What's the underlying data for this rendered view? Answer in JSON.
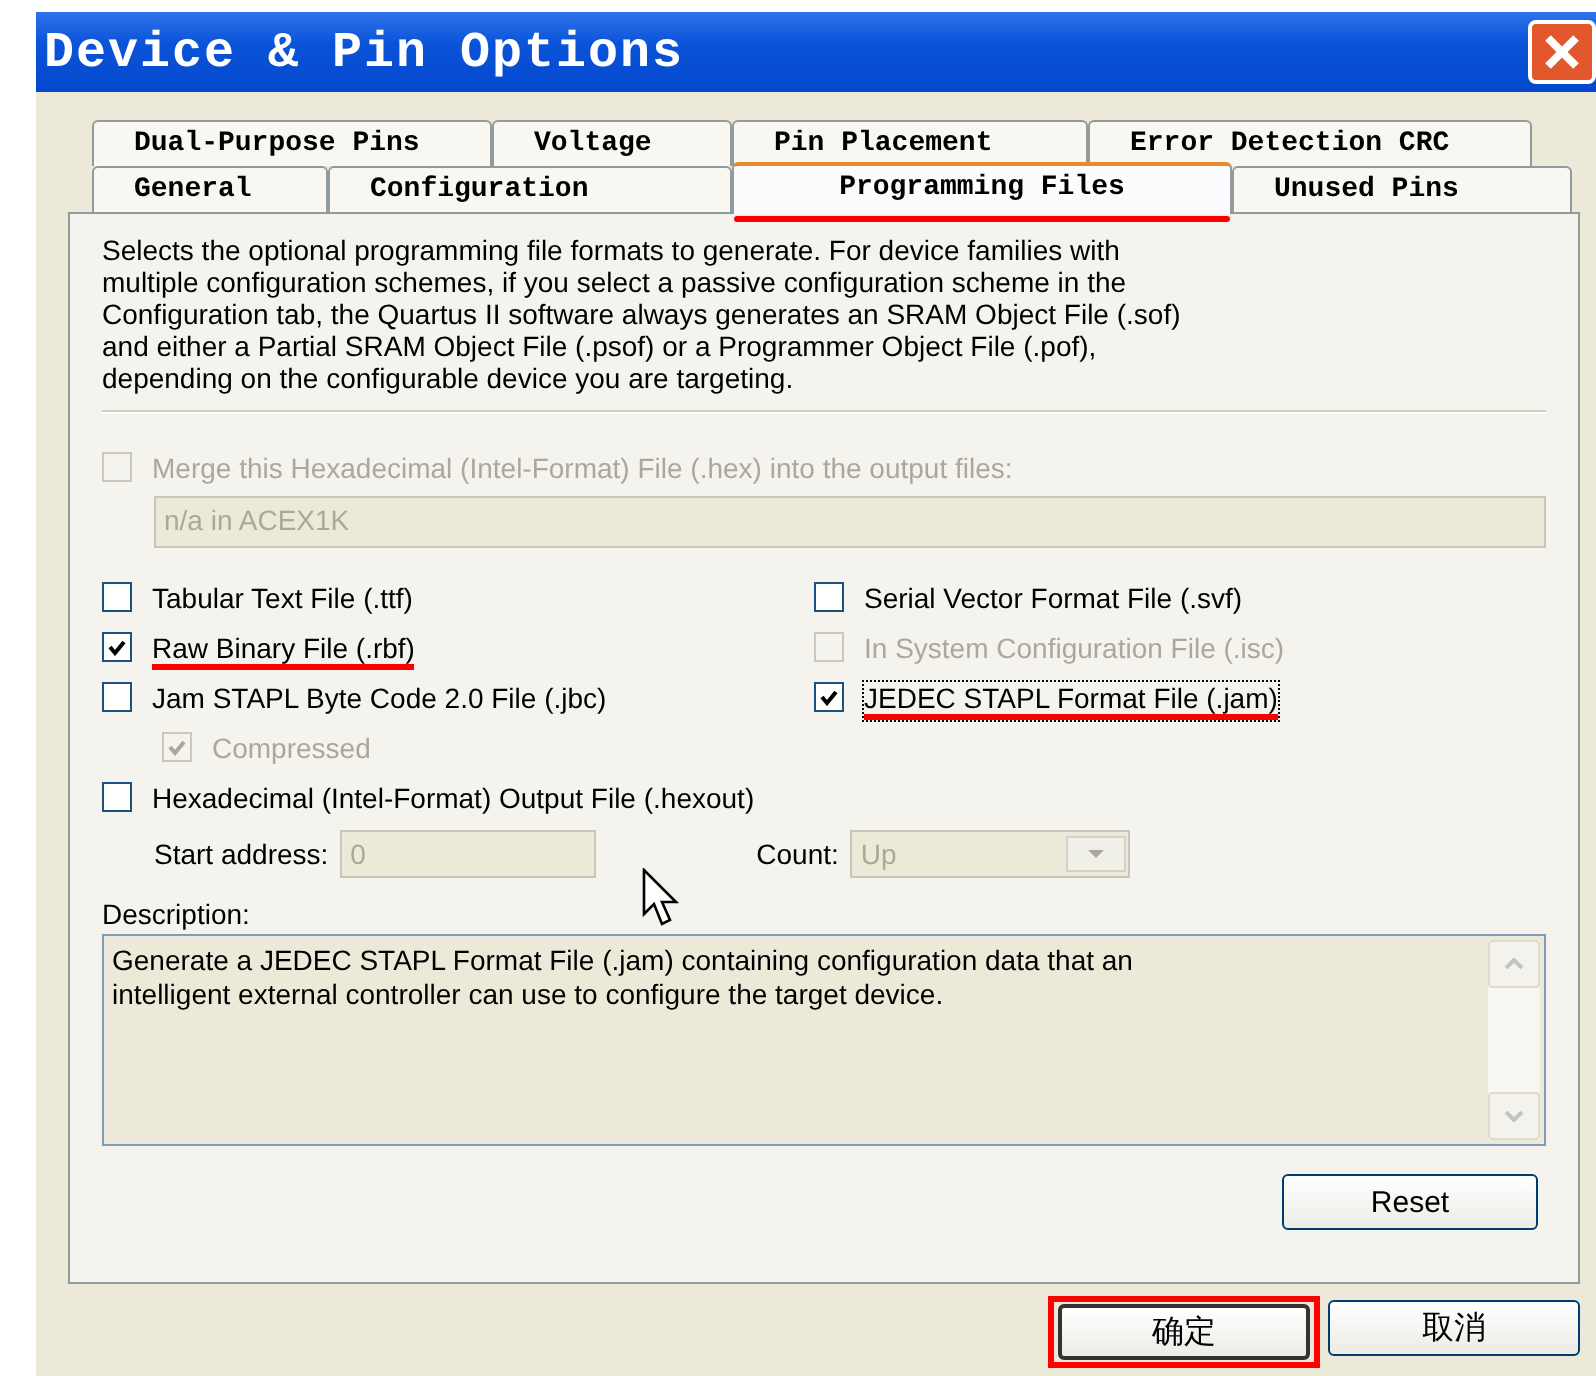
{
  "window": {
    "title": "Device & Pin Options"
  },
  "tab_rows": [
    {
      "tabs": [
        {
          "label": "Dual-Purpose Pins",
          "selected": false,
          "highlighted": false
        },
        {
          "label": "Voltage",
          "selected": false,
          "highlighted": false
        },
        {
          "label": "Pin Placement",
          "selected": false,
          "highlighted": false
        },
        {
          "label": "Error Detection CRC",
          "selected": false,
          "highlighted": false
        }
      ]
    },
    {
      "tabs": [
        {
          "label": "General",
          "selected": false,
          "highlighted": false
        },
        {
          "label": "Configuration",
          "selected": false,
          "highlighted": false
        },
        {
          "label": "Programming Files",
          "selected": true,
          "highlighted": true
        },
        {
          "label": "Unused Pins",
          "selected": false,
          "highlighted": false
        }
      ]
    }
  ],
  "intro": "Selects the optional programming file formats to generate. For device families with\nmultiple configuration schemes, if you select a passive configuration scheme in the\nConfiguration tab, the Quartus II software always generates an SRAM Object File (.sof)\nand either a Partial SRAM Object File (.psof) or a Programmer Object File (.pof),\ndepending on the configurable device you are targeting.",
  "merge": {
    "label": "Merge this Hexadecimal (Intel-Format) File (.hex) into the output files:",
    "checked": false,
    "disabled": true,
    "field": {
      "value": "n/a in ACEX1K",
      "disabled": true
    }
  },
  "option_rows": [
    {
      "options": [
        {
          "kind": "option",
          "label": "Tabular Text File (.ttf)",
          "checked": false,
          "disabled": false,
          "highlighted": false
        },
        {
          "kind": "option",
          "label": "Serial Vector Format File (.svf)",
          "checked": false,
          "disabled": false,
          "highlighted": false
        }
      ]
    },
    {
      "options": [
        {
          "kind": "option",
          "label": "Raw Binary File (.rbf)",
          "checked": true,
          "disabled": false,
          "highlighted": true
        },
        {
          "kind": "option",
          "label": "In System Configuration File (.isc)",
          "checked": false,
          "disabled": true,
          "highlighted": false
        }
      ]
    },
    {
      "options": [
        {
          "kind": "option",
          "label": "Jam STAPL Byte Code 2.0 File (.jbc)",
          "checked": false,
          "disabled": false,
          "highlighted": false
        },
        {
          "kind": "option",
          "label": "JEDEC STAPL Format File (.jam)",
          "checked": true,
          "disabled": false,
          "highlighted": true,
          "focused": true
        }
      ]
    },
    {
      "options": [
        {
          "kind": "sub-option",
          "label": "Compressed",
          "checked": true,
          "disabled": true,
          "highlighted": false
        }
      ]
    },
    {
      "options": [
        {
          "kind": "wide-option",
          "label": "Hexadecimal (Intel-Format) Output File (.hexout)",
          "checked": false,
          "disabled": false,
          "highlighted": false
        }
      ]
    }
  ],
  "start_address": {
    "label": "Start address:",
    "value": "0",
    "disabled": true
  },
  "count": {
    "label": "Count:",
    "value": "Up",
    "disabled": true
  },
  "description": {
    "label": "Description:",
    "text": "Generate a JEDEC STAPL Format File (.jam) containing configuration data that an\nintelligent external controller can use to configure the target device."
  },
  "reset_button": {
    "label": "Reset"
  },
  "buttons": [
    {
      "label": "确定",
      "default": true,
      "highlighted": true
    },
    {
      "label": "取消",
      "default": false,
      "highlighted": false
    }
  ]
}
